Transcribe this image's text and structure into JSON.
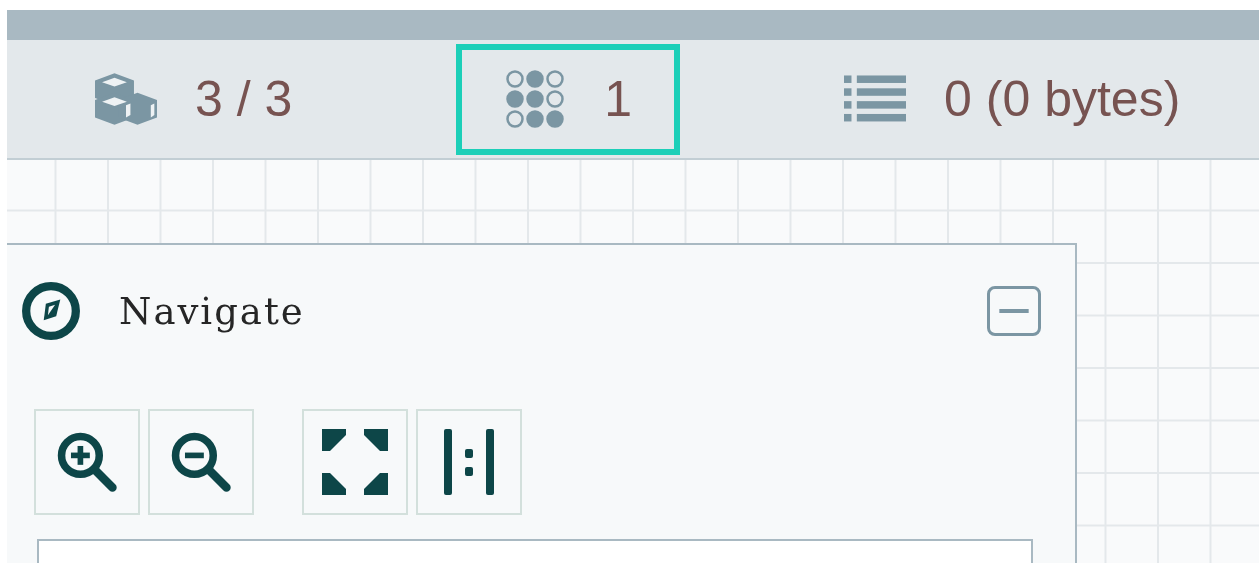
{
  "status_bar": [
    {
      "kind": "components",
      "value": "3 / 3",
      "highlighted": false
    },
    {
      "kind": "groups",
      "value": "1",
      "highlighted": true
    },
    {
      "kind": "queued",
      "value": "0 (0 bytes)",
      "highlighted": false
    }
  ],
  "navigate_panel": {
    "title": "Navigate",
    "collapsed": false,
    "tools": [
      {
        "kind": "zoom_in"
      },
      {
        "kind": "zoom_out"
      },
      {
        "kind": "fit"
      },
      {
        "kind": "actual_size"
      }
    ]
  }
}
